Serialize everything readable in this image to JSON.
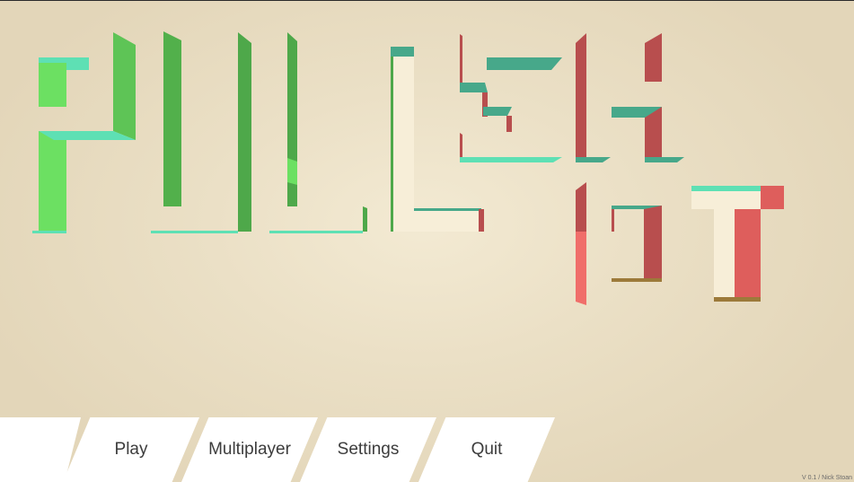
{
  "menu": {
    "items": [
      {
        "label": ""
      },
      {
        "label": "Play"
      },
      {
        "label": "Multiplayer"
      },
      {
        "label": "Settings"
      },
      {
        "label": "Quit"
      }
    ]
  },
  "footer": {
    "version": "V 0.1 / Nick Stoan"
  },
  "colors": {
    "green": "#6ce062",
    "green_dark": "#4ea84a",
    "teal": "#5ee0b4",
    "teal_dark": "#47a88a",
    "cream": "#f7eed8",
    "red": "#f06e6a",
    "red_dark": "#b84e4e"
  }
}
